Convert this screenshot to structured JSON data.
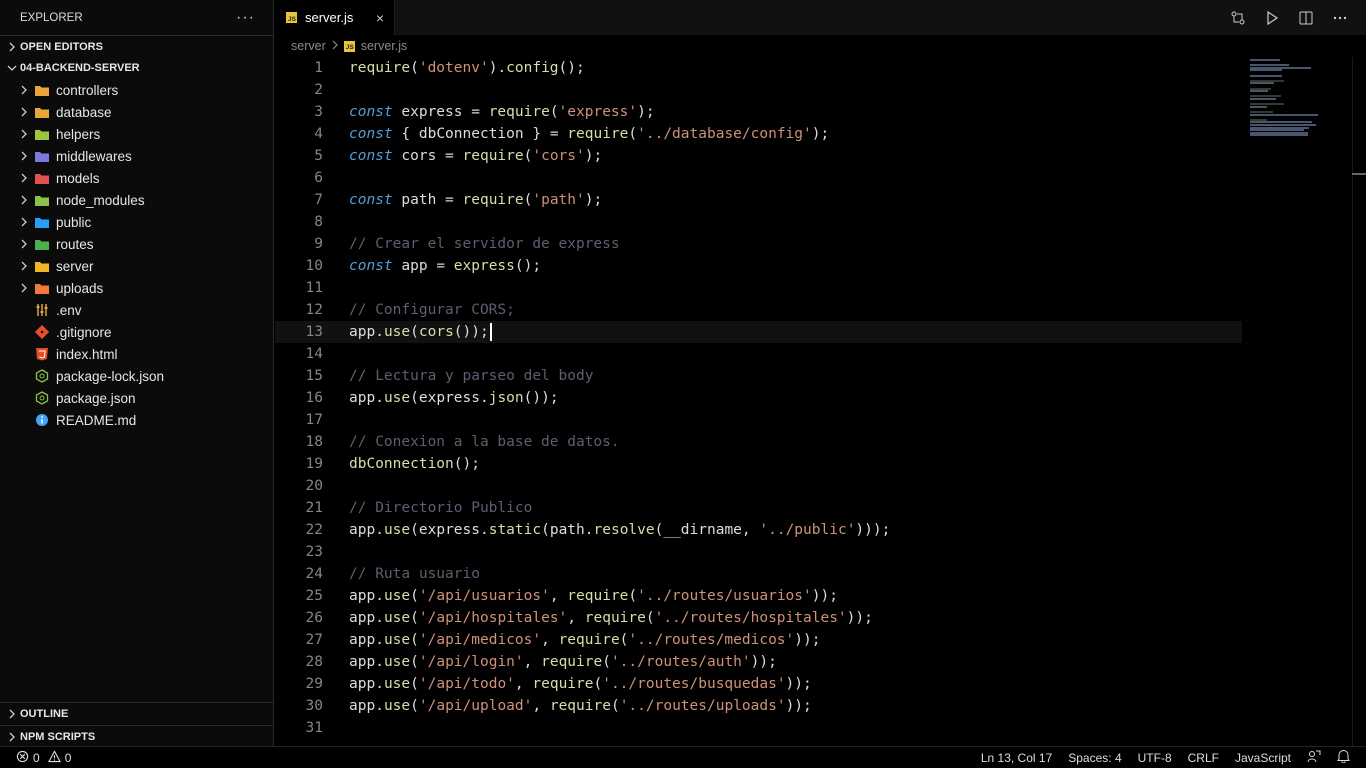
{
  "sidebar": {
    "title": "EXPLORER",
    "more": "···",
    "open_editors": "OPEN EDITORS",
    "project": "04-BACKEND-SERVER",
    "folders": [
      {
        "label": "controllers",
        "color": "#e8a63a"
      },
      {
        "label": "database",
        "color": "#e8a63a"
      },
      {
        "label": "helpers",
        "color": "#9bc53d"
      },
      {
        "label": "middlewares",
        "color": "#7a7adb"
      },
      {
        "label": "models",
        "color": "#e05252"
      },
      {
        "label": "node_modules",
        "color": "#8bc34a"
      },
      {
        "label": "public",
        "color": "#2a9df4"
      },
      {
        "label": "routes",
        "color": "#4caf50"
      },
      {
        "label": "server",
        "color": "#f0b429"
      },
      {
        "label": "uploads",
        "color": "#f07a3a"
      }
    ],
    "files": [
      {
        "label": ".env",
        "icon": "env-settings-icon"
      },
      {
        "label": ".gitignore",
        "icon": "git-icon"
      },
      {
        "label": "index.html",
        "icon": "html5-icon"
      },
      {
        "label": "package-lock.json",
        "icon": "nodejs-icon"
      },
      {
        "label": "package.json",
        "icon": "nodejs-icon"
      },
      {
        "label": "README.md",
        "icon": "info-icon"
      }
    ],
    "outline": "OUTLINE",
    "npm_scripts": "NPM SCRIPTS"
  },
  "tab": {
    "label": "server.js",
    "close": "×"
  },
  "breadcrumb": {
    "folder": "server",
    "file": "server.js"
  },
  "editor": {
    "current_line": 13,
    "lines": [
      [
        [
          "fn",
          "require"
        ],
        [
          "punc",
          "("
        ],
        [
          "str",
          "'dotenv'"
        ],
        [
          "punc",
          ")."
        ],
        [
          "fn",
          "config"
        ],
        [
          "punc",
          "();"
        ]
      ],
      [],
      [
        [
          "kw",
          "const"
        ],
        [
          "var",
          " express "
        ],
        [
          "op",
          "= "
        ],
        [
          "fn",
          "require"
        ],
        [
          "punc",
          "("
        ],
        [
          "str",
          "'express'"
        ],
        [
          "punc",
          ");"
        ]
      ],
      [
        [
          "kw",
          "const"
        ],
        [
          "punc",
          " { "
        ],
        [
          "var",
          "dbConnection"
        ],
        [
          "punc",
          " } "
        ],
        [
          "op",
          "= "
        ],
        [
          "fn",
          "require"
        ],
        [
          "punc",
          "("
        ],
        [
          "str",
          "'../database/config'"
        ],
        [
          "punc",
          ");"
        ]
      ],
      [
        [
          "kw",
          "const"
        ],
        [
          "var",
          " cors "
        ],
        [
          "op",
          "= "
        ],
        [
          "fn",
          "require"
        ],
        [
          "punc",
          "("
        ],
        [
          "str",
          "'cors'"
        ],
        [
          "punc",
          ");"
        ]
      ],
      [],
      [
        [
          "kw",
          "const"
        ],
        [
          "var",
          " path "
        ],
        [
          "op",
          "= "
        ],
        [
          "fn",
          "require"
        ],
        [
          "punc",
          "("
        ],
        [
          "str",
          "'path'"
        ],
        [
          "punc",
          ");"
        ]
      ],
      [],
      [
        [
          "cmt",
          "// Crear el servidor de express"
        ]
      ],
      [
        [
          "kw",
          "const"
        ],
        [
          "var",
          " app "
        ],
        [
          "op",
          "= "
        ],
        [
          "fn",
          "express"
        ],
        [
          "punc",
          "();"
        ]
      ],
      [],
      [
        [
          "cmt",
          "// Configurar CORS;"
        ]
      ],
      [
        [
          "var",
          "app"
        ],
        [
          "punc",
          "."
        ],
        [
          "fn",
          "use"
        ],
        [
          "punc",
          "("
        ],
        [
          "fn",
          "cors"
        ],
        [
          "punc",
          "());"
        ]
      ],
      [],
      [
        [
          "cmt",
          "// Lectura y parseo del body"
        ]
      ],
      [
        [
          "var",
          "app"
        ],
        [
          "punc",
          "."
        ],
        [
          "fn",
          "use"
        ],
        [
          "punc",
          "("
        ],
        [
          "var",
          "express"
        ],
        [
          "punc",
          "."
        ],
        [
          "fn",
          "json"
        ],
        [
          "punc",
          "());"
        ]
      ],
      [],
      [
        [
          "cmt",
          "// Conexion a la base de datos."
        ]
      ],
      [
        [
          "fn",
          "dbConnection"
        ],
        [
          "punc",
          "();"
        ]
      ],
      [],
      [
        [
          "cmt",
          "// Directorio Publico"
        ]
      ],
      [
        [
          "var",
          "app"
        ],
        [
          "punc",
          "."
        ],
        [
          "fn",
          "use"
        ],
        [
          "punc",
          "("
        ],
        [
          "var",
          "express"
        ],
        [
          "punc",
          "."
        ],
        [
          "fn",
          "static"
        ],
        [
          "punc",
          "("
        ],
        [
          "var",
          "path"
        ],
        [
          "punc",
          "."
        ],
        [
          "fn",
          "resolve"
        ],
        [
          "punc",
          "("
        ],
        [
          "var",
          "__dirname"
        ],
        [
          "punc",
          ", "
        ],
        [
          "str",
          "'../public'"
        ],
        [
          "punc",
          ")));"
        ]
      ],
      [],
      [
        [
          "cmt",
          "// Ruta usuario"
        ]
      ],
      [
        [
          "var",
          "app"
        ],
        [
          "punc",
          "."
        ],
        [
          "fn",
          "use"
        ],
        [
          "punc",
          "("
        ],
        [
          "str",
          "'/api/usuarios'"
        ],
        [
          "punc",
          ", "
        ],
        [
          "fn",
          "require"
        ],
        [
          "punc",
          "("
        ],
        [
          "str",
          "'../routes/usuarios'"
        ],
        [
          "punc",
          "));"
        ]
      ],
      [
        [
          "var",
          "app"
        ],
        [
          "punc",
          "."
        ],
        [
          "fn",
          "use"
        ],
        [
          "punc",
          "("
        ],
        [
          "str",
          "'/api/hospitales'"
        ],
        [
          "punc",
          ", "
        ],
        [
          "fn",
          "require"
        ],
        [
          "punc",
          "("
        ],
        [
          "str",
          "'../routes/hospitales'"
        ],
        [
          "punc",
          "));"
        ]
      ],
      [
        [
          "var",
          "app"
        ],
        [
          "punc",
          "."
        ],
        [
          "fn",
          "use"
        ],
        [
          "punc",
          "("
        ],
        [
          "str",
          "'/api/medicos'"
        ],
        [
          "punc",
          ", "
        ],
        [
          "fn",
          "require"
        ],
        [
          "punc",
          "("
        ],
        [
          "str",
          "'../routes/medicos'"
        ],
        [
          "punc",
          "));"
        ]
      ],
      [
        [
          "var",
          "app"
        ],
        [
          "punc",
          "."
        ],
        [
          "fn",
          "use"
        ],
        [
          "punc",
          "("
        ],
        [
          "str",
          "'/api/login'"
        ],
        [
          "punc",
          ", "
        ],
        [
          "fn",
          "require"
        ],
        [
          "punc",
          "("
        ],
        [
          "str",
          "'../routes/auth'"
        ],
        [
          "punc",
          "));"
        ]
      ],
      [
        [
          "var",
          "app"
        ],
        [
          "punc",
          "."
        ],
        [
          "fn",
          "use"
        ],
        [
          "punc",
          "("
        ],
        [
          "str",
          "'/api/todo'"
        ],
        [
          "punc",
          ", "
        ],
        [
          "fn",
          "require"
        ],
        [
          "punc",
          "("
        ],
        [
          "str",
          "'../routes/busquedas'"
        ],
        [
          "punc",
          "));"
        ]
      ],
      [
        [
          "var",
          "app"
        ],
        [
          "punc",
          "."
        ],
        [
          "fn",
          "use"
        ],
        [
          "punc",
          "("
        ],
        [
          "str",
          "'/api/upload'"
        ],
        [
          "punc",
          ", "
        ],
        [
          "fn",
          "require"
        ],
        [
          "punc",
          "("
        ],
        [
          "str",
          "'../routes/uploads'"
        ],
        [
          "punc",
          "));"
        ]
      ],
      []
    ]
  },
  "status": {
    "errors": "0",
    "warnings": "0",
    "position": "Ln 13, Col 17",
    "spaces": "Spaces: 4",
    "encoding": "UTF-8",
    "eol": "CRLF",
    "language": "JavaScript"
  },
  "colors": {
    "accent_js": "#e8c53a",
    "folder_default": "#e8a63a"
  }
}
